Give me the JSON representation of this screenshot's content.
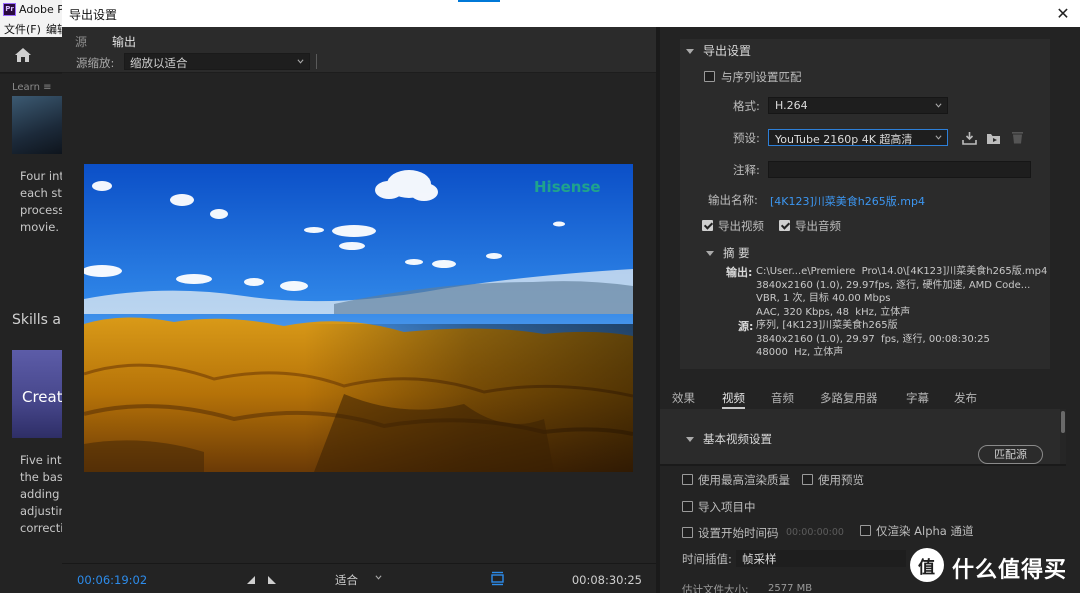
{
  "background_app": {
    "title": "Adobe P",
    "menu": [
      "文件(F)",
      "编辑"
    ],
    "learn_tab": "Learn",
    "learn_text_1": "Four int\neach ste\nprocess\nmovie.",
    "skills_heading": "Skills ar",
    "thumb2_label": "Creat",
    "learn_text_2": "Five inte\nthe basi\nadding t\nadjustin\ncorrecti"
  },
  "dialog": {
    "title": "导出设置",
    "close_glyph": "✕"
  },
  "left_panel": {
    "tabs": [
      "源",
      "输出"
    ],
    "active_tab": "输出",
    "source_scale_label": "源缩放:",
    "source_scale_value": "缩放以适合",
    "preview": {
      "watermark_text": "Hisense"
    },
    "timecode_current": "00:06:19:02",
    "timecode_duration": "00:08:30:25",
    "fit_value": "适合"
  },
  "export_settings": {
    "section_title": "导出设置",
    "match_sequence_label": "与序列设置匹配",
    "match_sequence_checked": false,
    "format_label": "格式:",
    "format_value": "H.264",
    "preset_label": "预设:",
    "preset_value": "YouTube 2160p 4K 超高清",
    "comment_label": "注释:",
    "comment_value": "",
    "output_name_label": "输出名称:",
    "output_name_value": "[4K123]川菜美食h265版.mp4",
    "export_video_label": "导出视频",
    "export_video_checked": true,
    "export_audio_label": "导出音频",
    "export_audio_checked": true,
    "summary_title": "摘 要",
    "summary_output_key": "输出:",
    "summary_output_lines": "C:\\User...e\\Premiere  Pro\\14.0\\[4K123]川菜美食h265版.mp4\n3840x2160 (1.0), 29.97fps, 逐行, 硬件加速, AMD Code...\nVBR, 1 次, 目标 40.00 Mbps\nAAC, 320 Kbps, 48  kHz, 立体声",
    "summary_source_key": "源:",
    "summary_source_lines": "序列, [4K123]川菜美食h265版\n3840x2160 (1.0), 29.97  fps, 逐行, 00:08:30:25\n48000  Hz, 立体声"
  },
  "panel_tabs": [
    "效果",
    "视频",
    "音频",
    "多路复用器",
    "字幕",
    "发布"
  ],
  "panel_active_tab": "视频",
  "video_section": {
    "title": "基本视频设置",
    "match_source_button": "匹配源"
  },
  "bottom_options": {
    "max_render_quality": "使用最高渲染质量",
    "use_previews": "使用预览",
    "import_into_project": "导入项目中",
    "set_start_timecode": "设置开始时间码",
    "start_timecode_value": "00:00:00:00",
    "render_alpha_only": "仅渲染 Alpha 通道",
    "time_interpolation_label": "时间插值:",
    "time_interpolation_value": "帧采样",
    "estimated_size_label": "估计文件大小:",
    "estimated_size_value": "2577 MB"
  },
  "watermark": {
    "glyph": "值",
    "text": "什么值得买"
  },
  "colors": {
    "accent_blue": "#2d8ceb",
    "panel_bg": "#2b2b2b",
    "dark_bg": "#232323"
  }
}
